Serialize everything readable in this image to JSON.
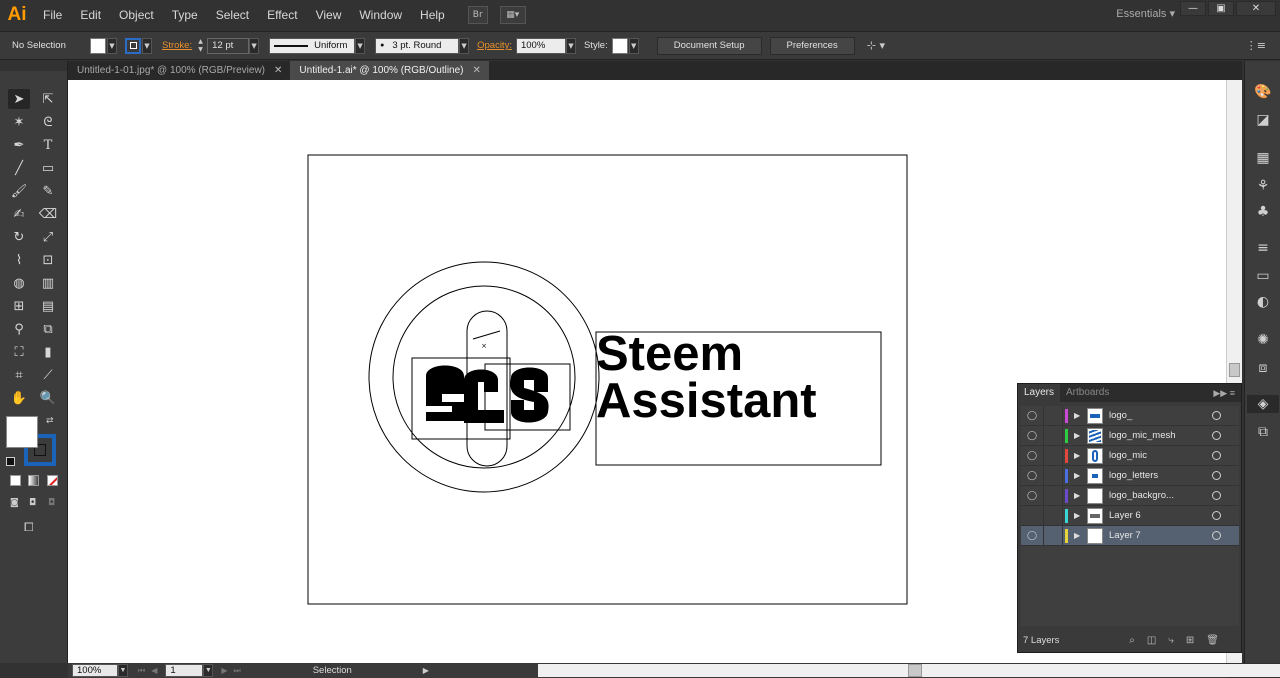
{
  "app": {
    "logo": "Ai",
    "workspace": "Essentials"
  },
  "menu": [
    "File",
    "Edit",
    "Object",
    "Type",
    "Select",
    "Effect",
    "View",
    "Window",
    "Help"
  ],
  "window_controls": {
    "minimize": "—",
    "maximize": "▣",
    "close": "✕"
  },
  "control_bar": {
    "selection": "No Selection",
    "stroke_label": "Stroke:",
    "stroke_weight": "12 pt",
    "stroke_profile": "Uniform",
    "brush": "3 pt. Round",
    "opacity_label": "Opacity:",
    "opacity": "100%",
    "style_label": "Style:",
    "document_setup": "Document Setup",
    "preferences": "Preferences"
  },
  "tabs": [
    {
      "label": "Untitled-1-01.jpg* @ 100% (RGB/Preview)",
      "active": false
    },
    {
      "label": "Untitled-1.ai* @ 100% (RGB/Outline)",
      "active": true
    }
  ],
  "artwork": {
    "line1": "Steem",
    "line2": "Assistant"
  },
  "status_bar": {
    "zoom": "100%",
    "artboard": "1",
    "tool": "Selection"
  },
  "layers_panel": {
    "tabs": [
      "Layers",
      "Artboards"
    ],
    "layers": [
      {
        "name": "logo_",
        "color": "#c94ad6",
        "visible": true,
        "selected": false
      },
      {
        "name": "logo_mic_mesh",
        "color": "#2ecc40",
        "visible": true,
        "selected": false
      },
      {
        "name": "logo_mic",
        "color": "#e0483b",
        "visible": true,
        "selected": false
      },
      {
        "name": "logo_letters",
        "color": "#4a6fe0",
        "visible": true,
        "selected": false
      },
      {
        "name": "logo_backgro...",
        "color": "#6a4ac9",
        "visible": true,
        "selected": false
      },
      {
        "name": "Layer 6",
        "color": "#3ad6d6",
        "visible": false,
        "selected": false
      },
      {
        "name": "Layer 7",
        "color": "#e8d23a",
        "visible": true,
        "selected": true
      }
    ],
    "count": "7 Layers"
  }
}
